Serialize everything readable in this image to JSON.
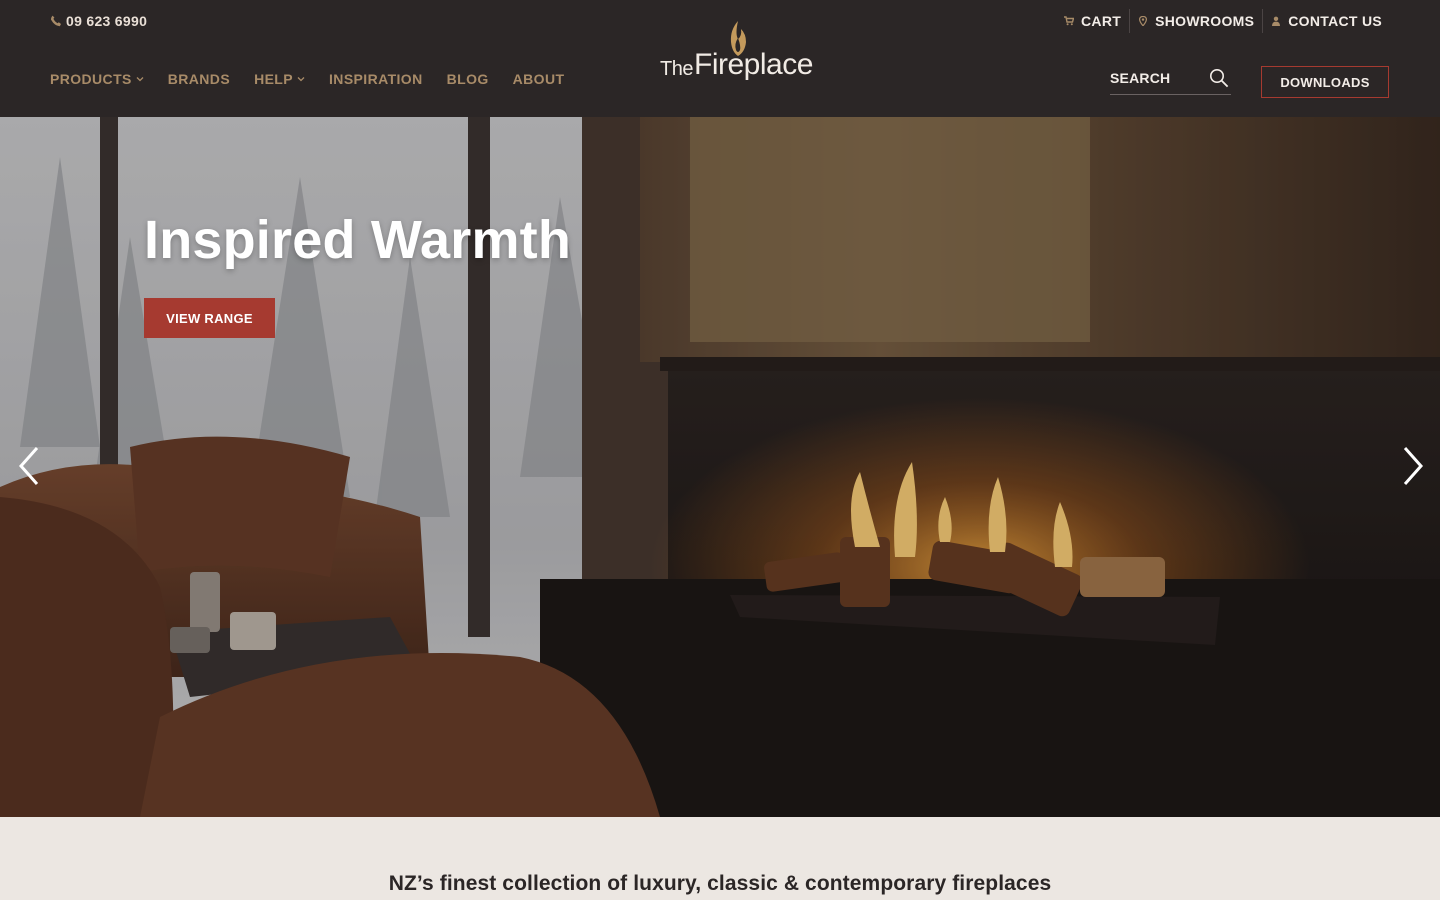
{
  "header": {
    "phone": "09 623 6990",
    "utility": {
      "cart": "CART",
      "showrooms": "SHOWROOMS",
      "contact": "CONTACT US"
    },
    "nav": {
      "products": "PRODUCTS",
      "brands": "BRANDS",
      "help": "HELP",
      "inspiration": "INSPIRATION",
      "blog": "BLOG",
      "about": "ABOUT"
    },
    "logo": {
      "the": "The",
      "fireplace": "Fireplace"
    },
    "search_placeholder": "SEARCH",
    "downloads": "DOWNLOADS"
  },
  "hero": {
    "title": "Inspired Warmth",
    "cta": "VIEW RANGE"
  },
  "tagline": "NZ’s finest collection of luxury, classic & contemporary fireplaces",
  "colors": {
    "header_bg": "#2b2626",
    "nav_gold": "#a88b68",
    "accent_red": "#a63a30",
    "page_bg": "#ece7e2"
  }
}
